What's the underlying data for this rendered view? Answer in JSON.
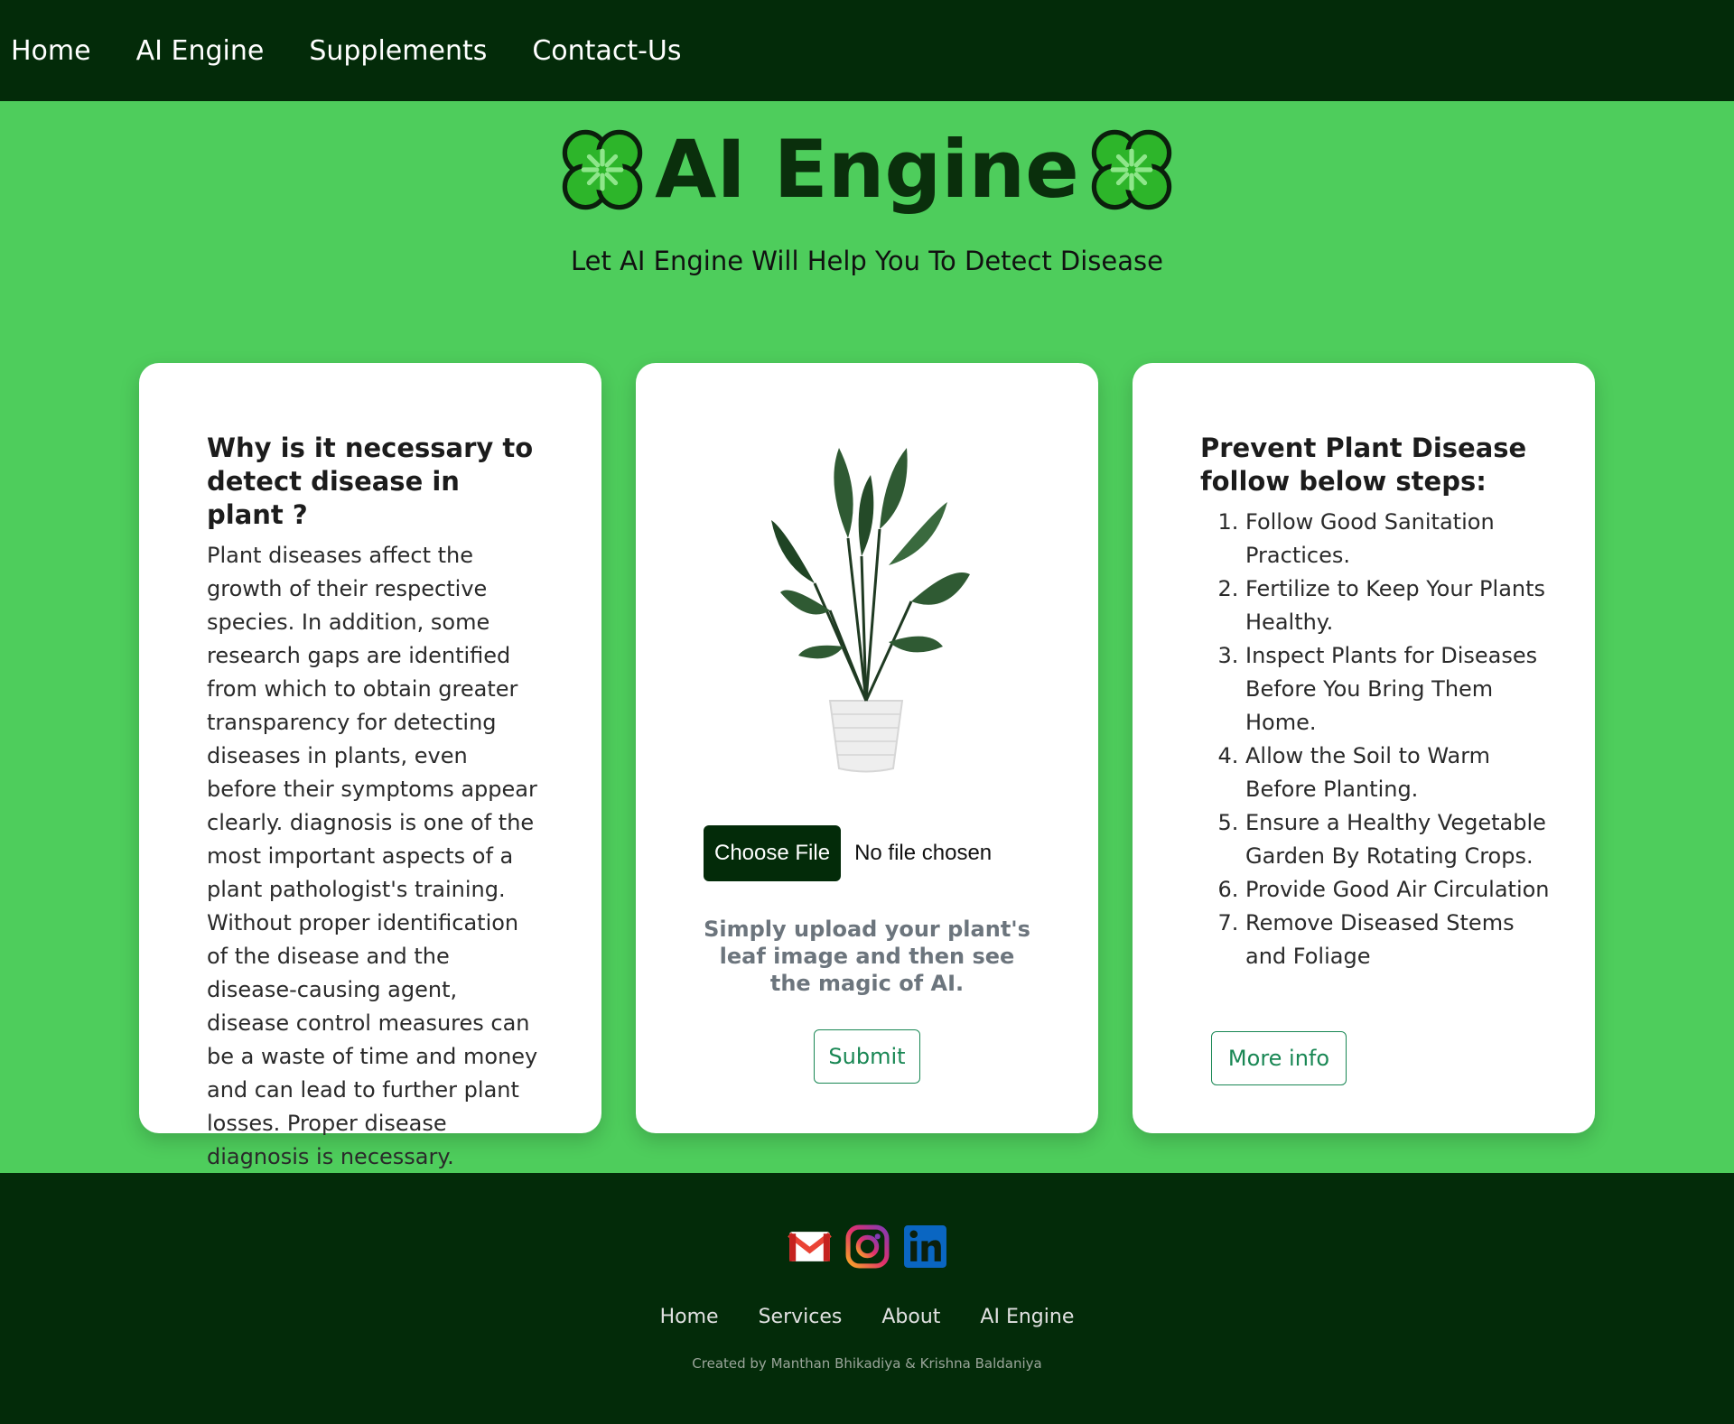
{
  "nav": {
    "items": [
      {
        "label": "Home"
      },
      {
        "label": "AI Engine"
      },
      {
        "label": "Supplements"
      },
      {
        "label": "Contact-Us"
      }
    ]
  },
  "hero": {
    "title": "AI Engine",
    "subtitle": "Let AI Engine Will Help You To Detect Disease",
    "icon": "four-leaf-clover-icon"
  },
  "left_card": {
    "heading": "Why is it necessary to detect disease in plant ?",
    "body": "Plant diseases affect the growth of their respective species. In addition, some research gaps are identified from which to obtain greater transparency for detecting diseases in plants, even before their symptoms appear clearly. diagnosis is one of the most important aspects of a plant pathologist's training. Without proper identification of the disease and the disease-causing agent, disease control measures can be a waste of time and money and can lead to further plant losses. Proper disease diagnosis is necessary."
  },
  "middle_card": {
    "choose_file_label": "Choose File",
    "file_status": "No file chosen",
    "help_text": "Simply upload your plant's leaf image and then see the magic of AI.",
    "submit_label": "Submit"
  },
  "right_card": {
    "heading": "Prevent Plant Disease follow below steps:",
    "steps": [
      "Follow Good Sanitation Practices.",
      "Fertilize to Keep Your Plants Healthy.",
      "Inspect Plants for Diseases Before You Bring Them Home.",
      "Allow the Soil to Warm Before Planting.",
      "Ensure a Healthy Vegetable Garden By Rotating Crops.",
      "Provide Good Air Circulation",
      "Remove Diseased Stems and Foliage"
    ],
    "more_info_label": "More info"
  },
  "footer": {
    "social": [
      "gmail-icon",
      "instagram-icon",
      "linkedin-icon"
    ],
    "links": [
      {
        "label": "Home"
      },
      {
        "label": "Services"
      },
      {
        "label": "About"
      },
      {
        "label": "AI Engine"
      }
    ],
    "credit": "Created by Manthan Bhikadiya & Krishna Baldaniya"
  },
  "colors": {
    "nav_bg": "#032b09",
    "page_bg": "#4ecd5c",
    "accent_green": "#198754",
    "title_green": "#0a2f0c"
  }
}
